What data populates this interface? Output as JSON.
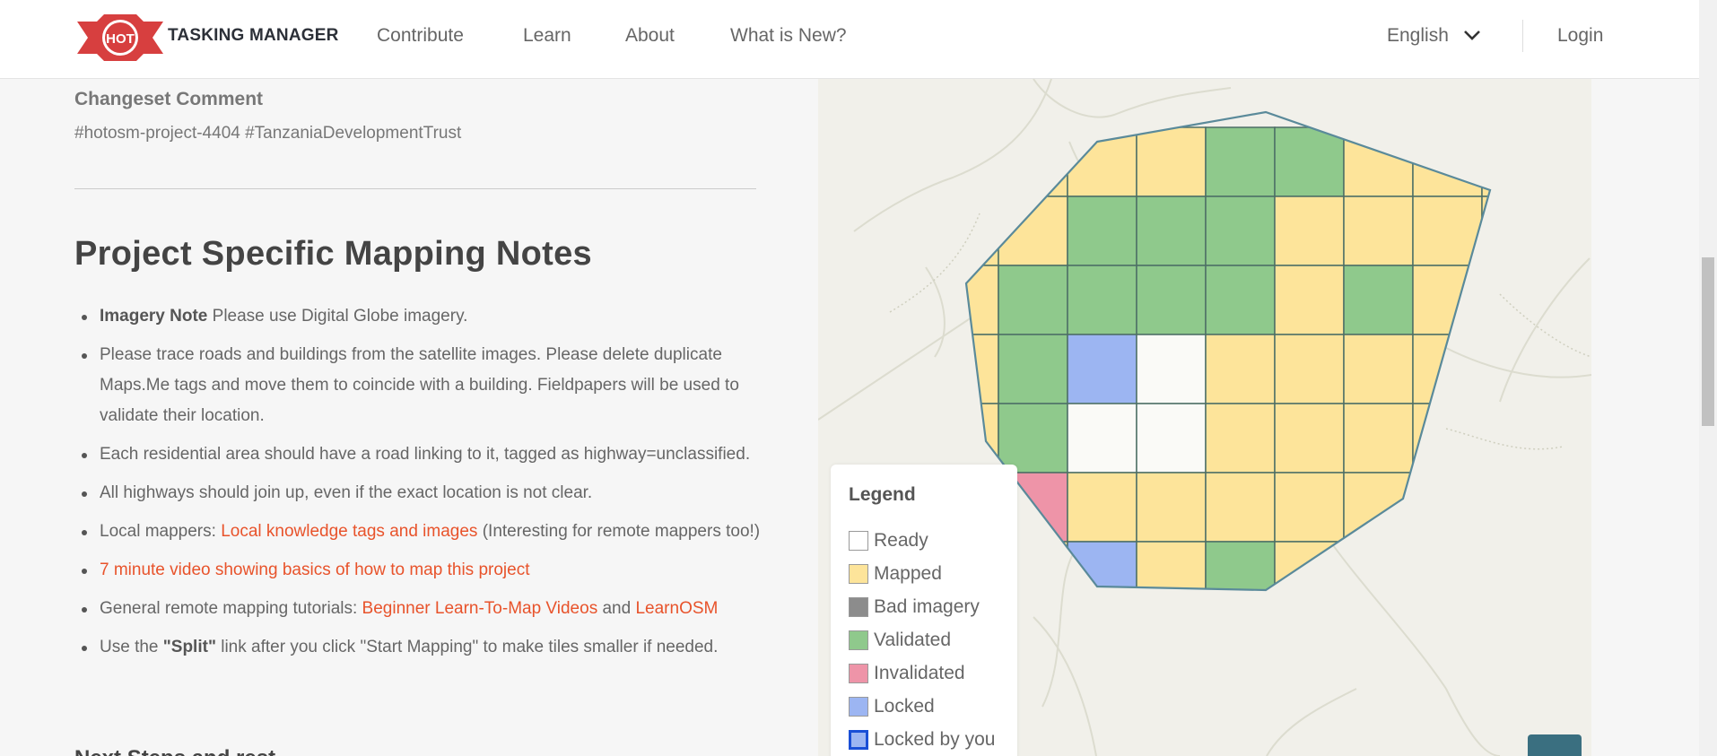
{
  "navbar": {
    "logo_text": "HOT",
    "brand": "TASKING MANAGER",
    "links": [
      "Contribute",
      "Learn",
      "About",
      "What is New?"
    ],
    "language": "English",
    "login": "Login"
  },
  "changeset": {
    "title": "Changeset Comment",
    "text": "#hotosm-project-4404 #TanzaniaDevelopmentTrust"
  },
  "notes": {
    "title": "Project Specific Mapping Notes",
    "items": [
      {
        "bold": "Imagery Note",
        "text": " Please use Digital Globe imagery."
      },
      {
        "text": "Please trace roads and buildings from the satellite images. Please delete duplicate Maps.Me tags and move them to coincide with a building. Fieldpapers will be used to validate their location."
      },
      {
        "text": "Each residential area should have a road linking to it, tagged as highway=unclassified."
      },
      {
        "text": "All highways should join up, even if the exact location is not clear."
      },
      {
        "pre": "Local mappers: ",
        "link": "Local knowledge tags and images",
        "post": " (Interesting for remote mappers too!)"
      },
      {
        "link": "7 minute video showing basics of how to map this project"
      },
      {
        "pre": "General remote mapping tutorials: ",
        "link": "Beginner Learn-To-Map Videos",
        "mid": " and ",
        "link2": "LearnOSM"
      },
      {
        "pre": "Use the ",
        "bold": "\"Split\"",
        "post": " link after you click \"Start Mapping\" to make tiles smaller if needed."
      }
    ],
    "next_heading": "Next Steps and rest"
  },
  "legend": {
    "title": "Legend",
    "items": [
      {
        "label": "Ready",
        "color": "#ffffff"
      },
      {
        "label": "Mapped",
        "color": "#fde49a"
      },
      {
        "label": "Bad imagery",
        "color": "#8c8c8c"
      },
      {
        "label": "Validated",
        "color": "#8fc98c"
      },
      {
        "label": "Invalidated",
        "color": "#ee94a8"
      },
      {
        "label": "Locked",
        "color": "#9cb5f2"
      },
      {
        "label": "Locked by you",
        "color": "#9cb5f2",
        "border": "#1a4fd6"
      }
    ]
  },
  "colors": {
    "link": "#e8532b",
    "ready": "#fafaf7",
    "mapped": "#fde49a",
    "validated": "#8fc98c",
    "invalidated": "#ee94a8",
    "locked": "#9cb5f2",
    "map_bg": "#f1f0ea"
  },
  "map_tiles": [
    "...MVV...",
    "..VVVMMM.",
    ".VVVVMVM.",
    "MVLRMMMM.",
    "MVRRMMMM.",
    ".IMMMMMM.",
    "..LMVMM..",
    "..MMVM..."
  ]
}
